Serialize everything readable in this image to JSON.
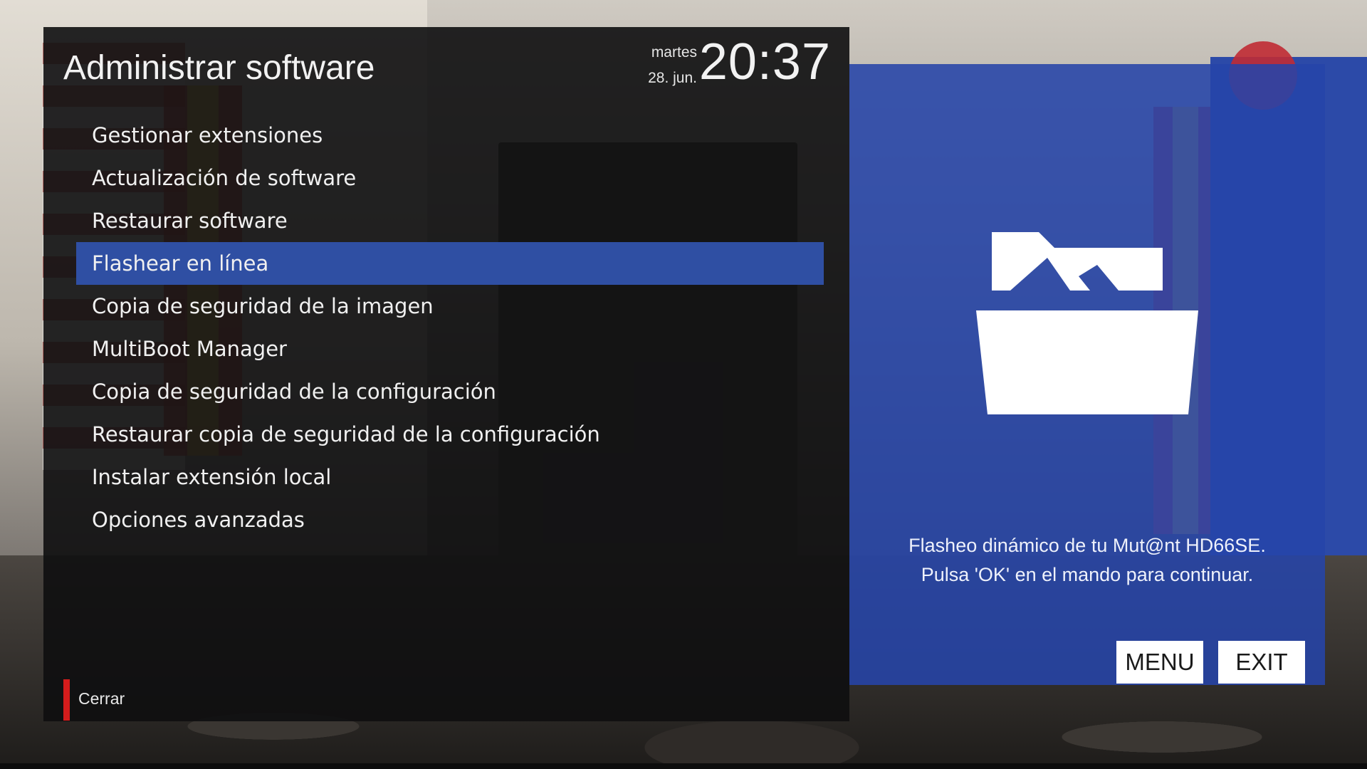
{
  "screen": {
    "title": "Administrar software",
    "day": "martes",
    "date": "28. jun.",
    "time": "20:37"
  },
  "menu": {
    "items": [
      {
        "label": "Gestionar extensiones"
      },
      {
        "label": "Actualización de software"
      },
      {
        "label": "Restaurar software"
      },
      {
        "label": "Flashear en línea",
        "selected": true
      },
      {
        "label": "Copia de seguridad de la imagen"
      },
      {
        "label": "MultiBoot Manager"
      },
      {
        "label": "Copia de seguridad de la configuración"
      },
      {
        "label": "Restaurar copia de seguridad de la configuración"
      },
      {
        "label": "Instalar extensión local"
      },
      {
        "label": "Opciones avanzadas"
      }
    ]
  },
  "footer": {
    "red_key_label": "Cerrar",
    "red_key_color": "#d41c1c"
  },
  "info": {
    "icon": "open-folder-icon",
    "line1": "Flasheo dinámico de tu Mut@nt HD66SE.",
    "line2": "Pulsa 'OK' en el mando para continuar.",
    "menu_key": "MENU",
    "exit_key": "EXIT"
  },
  "colors": {
    "panel_bg": "#0e0e10",
    "selection": "#2f4fa3",
    "info_bg": "#2644a8",
    "text": "#f0f0f0"
  }
}
